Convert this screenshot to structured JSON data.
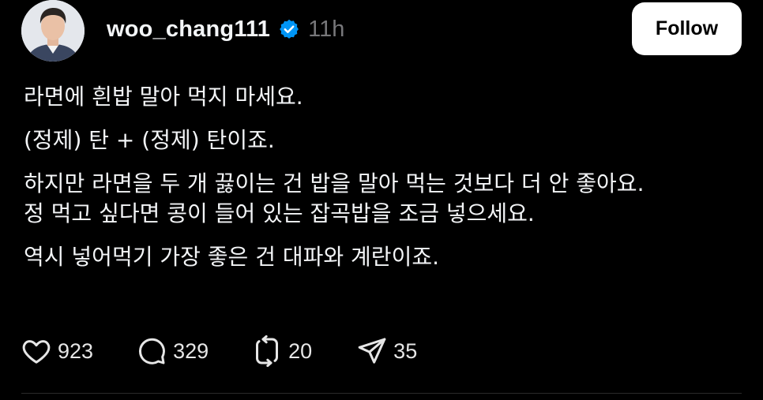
{
  "post": {
    "username": "woo_chang111",
    "timestamp": "11h",
    "follow_label": "Follow",
    "paragraphs": [
      [
        "라면에 흰밥 말아 먹지 마세요."
      ],
      [
        "(정제) 탄 + (정제) 탄이죠."
      ],
      [
        "하지만 라면을 두 개 끓이는 건 밥을 말아 먹는 것보다 더 안 좋아요.",
        "정 먹고 싶다면 콩이 들어 있는 잡곡밥을 조금 넣으세요."
      ],
      [
        "역시 넣어먹기 가장 좋은 건 대파와 계란이죠."
      ]
    ],
    "actions": {
      "likes": "923",
      "replies": "329",
      "reposts": "20",
      "shares": "35"
    }
  },
  "colors": {
    "background": "#000000",
    "text": "#f3f5f7",
    "muted": "#77777a",
    "verified": "#0095f6",
    "button_bg": "#ffffff",
    "button_text": "#000000"
  },
  "icons": [
    "verified-badge-icon",
    "heart-icon",
    "reply-bubble-icon",
    "repost-icon",
    "share-send-icon"
  ]
}
